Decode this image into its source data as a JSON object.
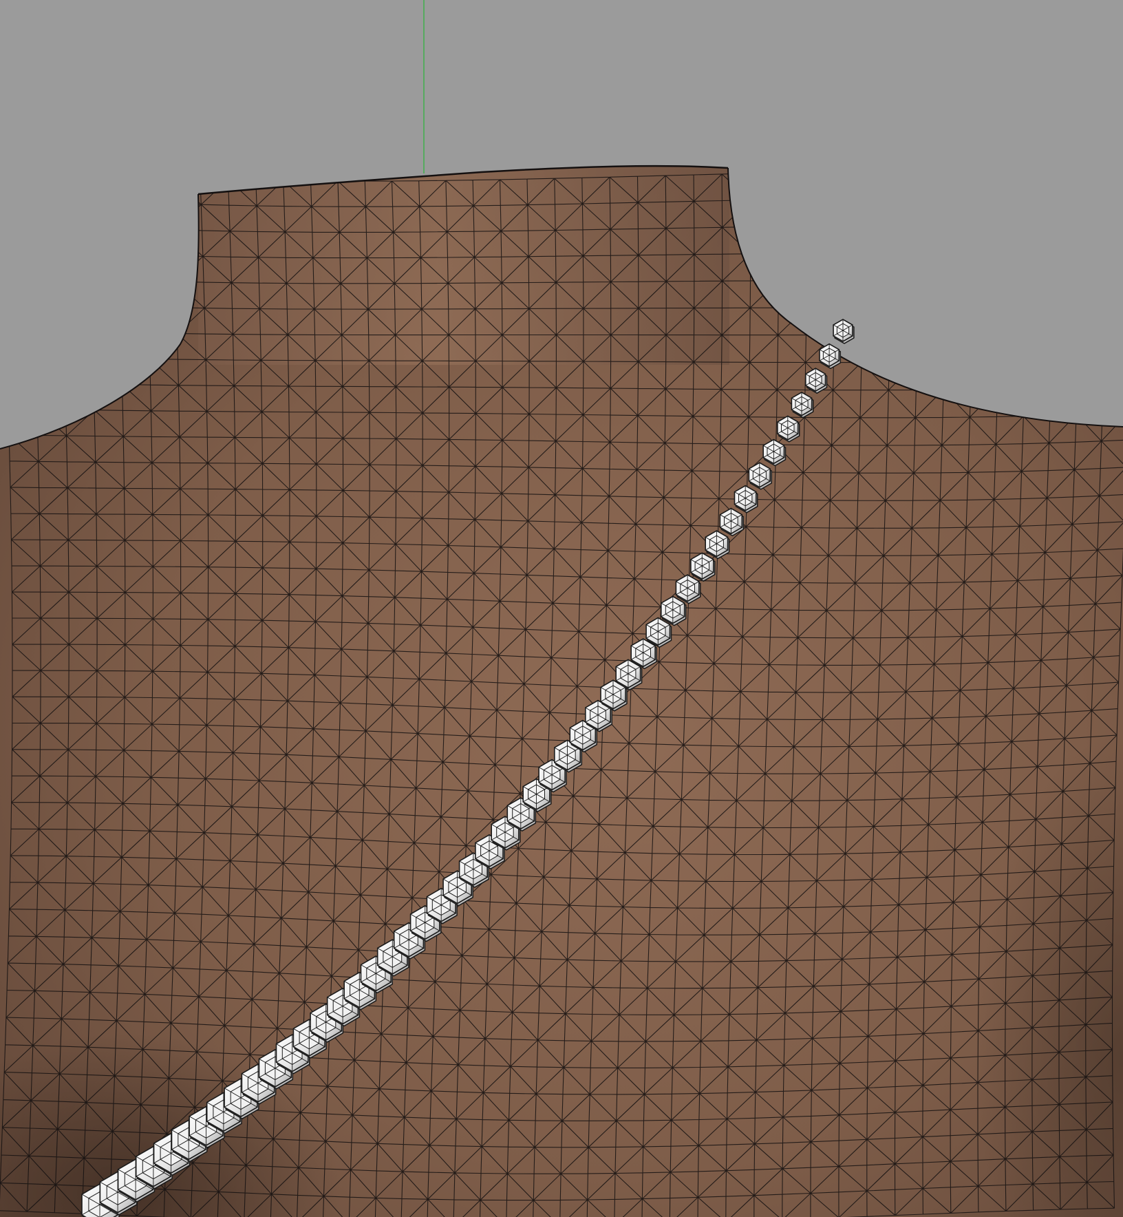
{
  "viewport": {
    "background_color": "#9b9b9b",
    "axis_line_color": "#3fb04a"
  },
  "mannequin": {
    "surface_color_light": "#8d6a55",
    "surface_color_mid": "#7a5a47",
    "surface_color_dark": "#5a4133",
    "wire_color": "#141010"
  },
  "necklace": {
    "stone_fill": "#f2f2f2",
    "stone_shade": "#bdbdbd",
    "stone_outline": "#1a1a1a",
    "stone_shape": "hexagon-icon"
  }
}
